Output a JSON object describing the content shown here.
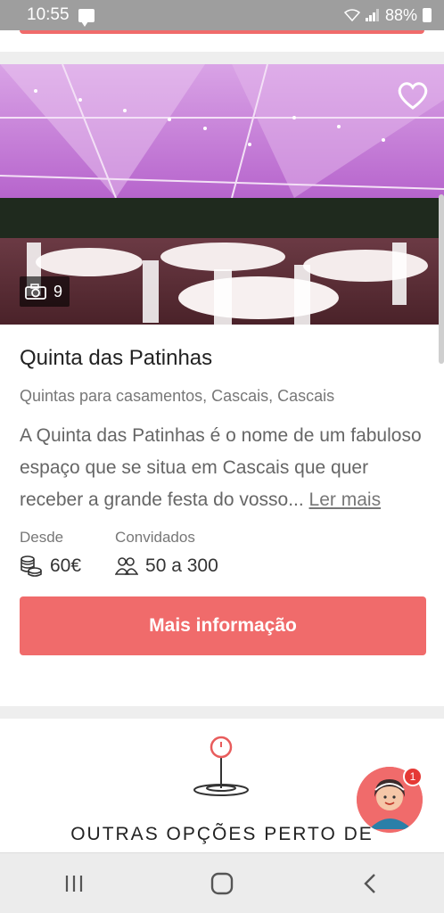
{
  "status_bar": {
    "time": "10:55",
    "battery": "88%"
  },
  "venue": {
    "photo_count": "9",
    "title": "Quinta das Patinhas",
    "category": "Quintas para casamentos, Cascais, Cascais",
    "description": "A Quinta das Patinhas é o nome de um fabuloso espaço que se situa em Cascais que quer receber a grande festa do vosso...",
    "read_more": "Ler mais",
    "price_label": "Desde",
    "price_value": "60€",
    "guests_label": "Convidados",
    "guests_value": "50 a 300",
    "cta_label": "Mais informação"
  },
  "nearby": {
    "title": "OUTRAS OPÇÕES PERTO DE"
  },
  "chat": {
    "badge_count": "1"
  },
  "colors": {
    "accent": "#f06b6b",
    "status_bar": "#9e9e9e"
  },
  "icons": [
    "message-icon",
    "wifi-icon",
    "signal-icon",
    "battery-icon",
    "heart-icon",
    "camera-icon",
    "coins-icon",
    "guests-icon",
    "location-pin-icon",
    "recents-icon",
    "home-icon",
    "back-icon"
  ]
}
